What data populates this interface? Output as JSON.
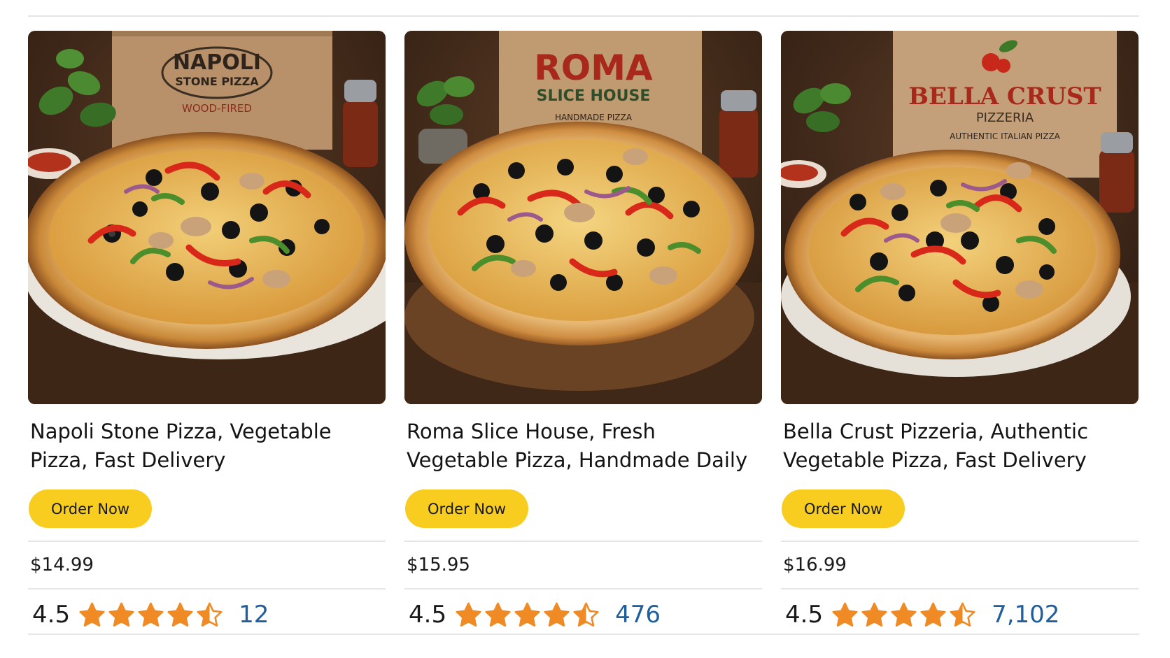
{
  "products": [
    {
      "title": "Napoli Stone Pizza, Vegetable Pizza, Fast Delivery",
      "box_brand": "NAPOLI",
      "box_sub": "STONE PIZZA",
      "box_tag": "WOOD-FIRED",
      "button_label": "Order Now",
      "price": "$14.99",
      "rating": "4.5",
      "rating_value": 4.5,
      "review_count": "12"
    },
    {
      "title": "Roma Slice House, Fresh Vegetable Pizza, Handmade Daily",
      "box_brand": "ROMA",
      "box_sub": "SLICE HOUSE",
      "box_tag": "HANDMADE PIZZA",
      "button_label": "Order Now",
      "price": "$15.95",
      "rating": "4.5",
      "rating_value": 4.5,
      "review_count": "476"
    },
    {
      "title": "Bella Crust Pizzeria, Authentic Vegetable Pizza, Fast Delivery",
      "box_brand": "BELLA CRUST",
      "box_sub": "PIZZERIA",
      "box_tag": "AUTHENTIC ITALIAN PIZZA",
      "button_label": "Order Now",
      "price": "$16.99",
      "rating": "4.5",
      "rating_value": 4.5,
      "review_count": "7,102"
    }
  ],
  "colors": {
    "button": "#f8cd1f",
    "star": "#f08a24",
    "review_link": "#1f5f9e"
  }
}
